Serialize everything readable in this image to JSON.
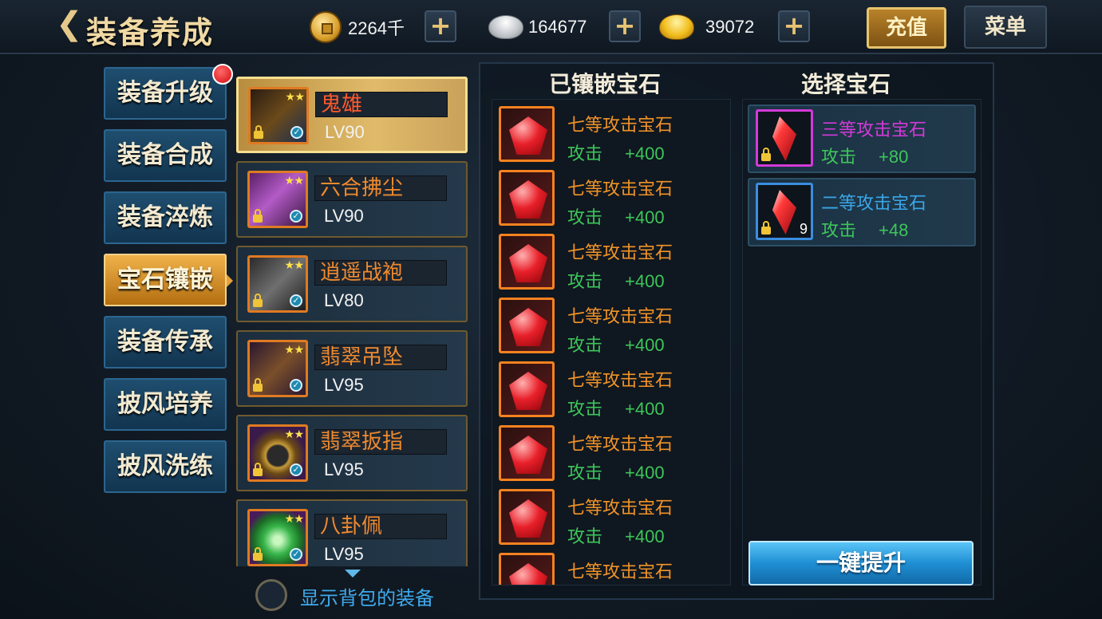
{
  "header": {
    "title": "装备养成",
    "coins": "2264千",
    "silver": "164677",
    "gold": "39072",
    "recharge_label": "充值",
    "menu_label": "菜单"
  },
  "nav": {
    "items": [
      {
        "label": "装备升级"
      },
      {
        "label": "装备合成"
      },
      {
        "label": "装备淬炼"
      },
      {
        "label": "宝石镶嵌"
      },
      {
        "label": "装备传承"
      },
      {
        "label": "披风培养"
      },
      {
        "label": "披风洗练"
      }
    ],
    "active": "宝石镶嵌"
  },
  "equipment": {
    "items": [
      {
        "name": "鬼雄",
        "level": "LV90"
      },
      {
        "name": "六合拂尘",
        "level": "LV90"
      },
      {
        "name": "逍遥战袍",
        "level": "LV80"
      },
      {
        "name": "翡翠吊坠",
        "level": "LV95"
      },
      {
        "name": "翡翠扳指",
        "level": "LV95"
      },
      {
        "name": "八卦佩",
        "level": "LV95"
      }
    ],
    "show_bag_label": "显示背包的装备"
  },
  "embedded": {
    "title": "已镶嵌宝石",
    "gems": [
      {
        "name": "七等攻击宝石",
        "attr": "攻击",
        "value": "+400"
      },
      {
        "name": "七等攻击宝石",
        "attr": "攻击",
        "value": "+400"
      },
      {
        "name": "七等攻击宝石",
        "attr": "攻击",
        "value": "+400"
      },
      {
        "name": "七等攻击宝石",
        "attr": "攻击",
        "value": "+400"
      },
      {
        "name": "七等攻击宝石",
        "attr": "攻击",
        "value": "+400"
      },
      {
        "name": "七等攻击宝石",
        "attr": "攻击",
        "value": "+400"
      },
      {
        "name": "七等攻击宝石",
        "attr": "攻击",
        "value": "+400"
      },
      {
        "name": "七等攻击宝石"
      }
    ]
  },
  "select": {
    "title": "选择宝石",
    "gems": [
      {
        "name": "三等攻击宝石",
        "attr": "攻击",
        "value": "+80",
        "color": "#d33ad8"
      },
      {
        "name": "二等攻击宝石",
        "attr": "攻击",
        "value": "+48",
        "count": "9",
        "color": "#3aa6e8"
      }
    ],
    "upgrade_label": "一键提升"
  }
}
